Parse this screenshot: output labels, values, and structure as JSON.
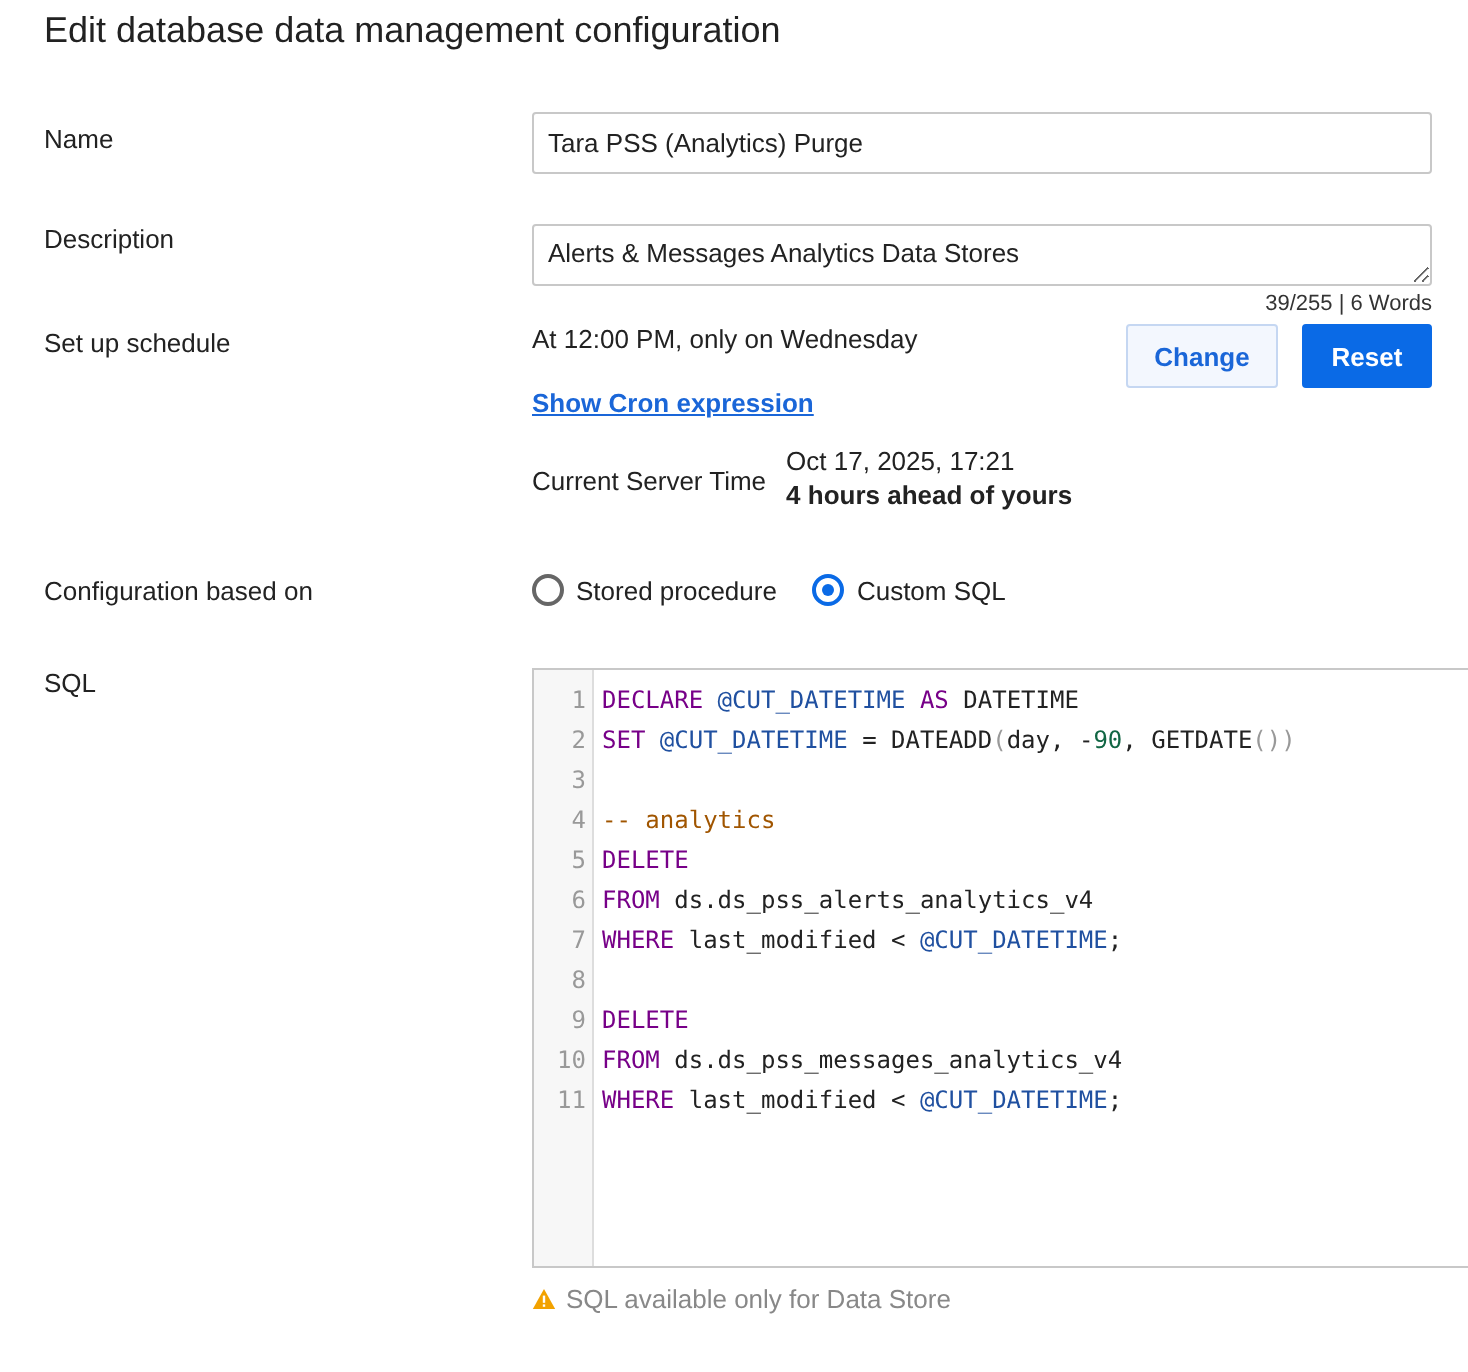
{
  "title": "Edit database data management configuration",
  "name": {
    "label": "Name",
    "value": "Tara PSS (Analytics) Purge"
  },
  "description": {
    "label": "Description",
    "value": "Alerts & Messages Analytics Data Stores",
    "counter": "39/255 | 6 Words"
  },
  "schedule": {
    "label": "Set up schedule",
    "summary": "At 12:00 PM, only on Wednesday",
    "buttons": [
      {
        "label": "Change",
        "kind": "secondary"
      },
      {
        "label": "Reset",
        "kind": "primary"
      }
    ],
    "cron_link": "Show Cron expression",
    "server_time_label": "Current Server Time",
    "server_time": "Oct 17, 2025, 17:21",
    "offset": "4 hours ahead of yours"
  },
  "configuration": {
    "label": "Configuration based on",
    "options": [
      {
        "label": "Stored procedure",
        "selected": false
      },
      {
        "label": "Custom SQL",
        "selected": true
      }
    ]
  },
  "sql": {
    "label": "SQL",
    "lines": [
      {
        "number": "1",
        "tokens": [
          {
            "kind": "keyword",
            "text": "DECLARE"
          },
          {
            "kind": "variable",
            "text": " @CUT_DATETIME"
          },
          {
            "kind": "keyword",
            "text": " AS"
          },
          {
            "kind": "plain",
            "text": " DATETIME"
          }
        ]
      },
      {
        "number": "2",
        "tokens": [
          {
            "kind": "keyword",
            "text": "SET"
          },
          {
            "kind": "variable",
            "text": " @CUT_DATETIME"
          },
          {
            "kind": "plain",
            "text": " = DATEADD"
          },
          {
            "kind": "punct",
            "text": "("
          },
          {
            "kind": "plain",
            "text": "day, -"
          },
          {
            "kind": "number",
            "text": "90"
          },
          {
            "kind": "plain",
            "text": ", GETDATE"
          },
          {
            "kind": "punct",
            "text": "())"
          }
        ]
      },
      {
        "number": "3"
      },
      {
        "number": "4",
        "tokens": [
          {
            "kind": "comment",
            "text": "-- analytics"
          }
        ]
      },
      {
        "number": "5",
        "tokens": [
          {
            "kind": "keyword",
            "text": "DELETE"
          }
        ]
      },
      {
        "number": "6",
        "tokens": [
          {
            "kind": "keyword",
            "text": "FROM"
          },
          {
            "kind": "plain",
            "text": " ds.ds_pss_alerts_analytics_v4"
          }
        ]
      },
      {
        "number": "7",
        "tokens": [
          {
            "kind": "keyword",
            "text": "WHERE"
          },
          {
            "kind": "plain",
            "text": " last_modified < "
          },
          {
            "kind": "variable",
            "text": "@CUT_DATETIME"
          },
          {
            "kind": "plain",
            "text": ";"
          }
        ]
      },
      {
        "number": "8"
      },
      {
        "number": "9",
        "tokens": [
          {
            "kind": "keyword",
            "text": "DELETE"
          }
        ]
      },
      {
        "number": "10",
        "tokens": [
          {
            "kind": "keyword",
            "text": "FROM"
          },
          {
            "kind": "plain",
            "text": " ds.ds_pss_messages_analytics_v4"
          }
        ]
      },
      {
        "number": "11",
        "tokens": [
          {
            "kind": "keyword",
            "text": "WHERE"
          },
          {
            "kind": "plain",
            "text": " last_modified < "
          },
          {
            "kind": "variable",
            "text": "@CUT_DATETIME"
          },
          {
            "kind": "plain",
            "text": ";"
          }
        ]
      }
    ],
    "warning": "SQL available only for Data Store"
  }
}
